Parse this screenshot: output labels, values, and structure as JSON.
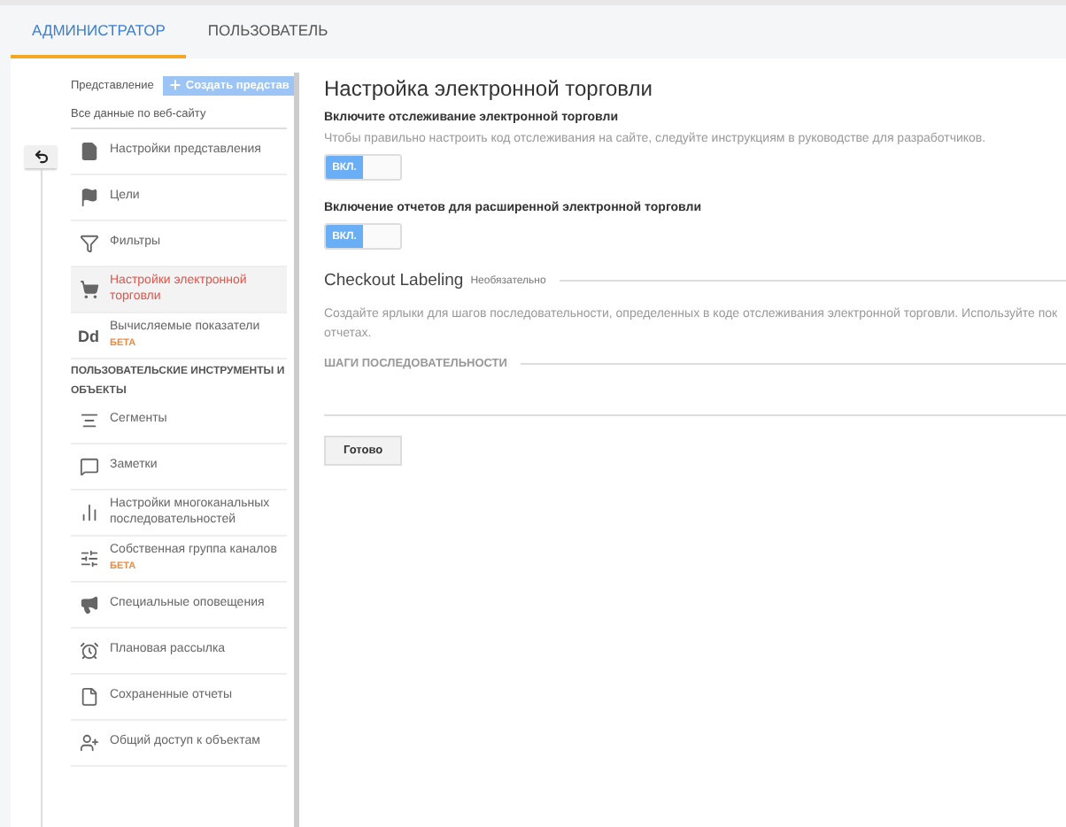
{
  "tabs": [
    {
      "label": "АДМИНИСТРАТОР",
      "selected": true
    },
    {
      "label": "ПОЛЬЗОВАТЕЛЬ",
      "selected": false
    }
  ],
  "view": {
    "label": "Представление",
    "create_button": "Создать представ",
    "subtitle": "Все данные по веб-сайту"
  },
  "nav_items": [
    {
      "kind": "item",
      "label": "Настройки представления",
      "selected": false
    },
    {
      "kind": "item",
      "label": "Цели",
      "selected": false
    },
    {
      "kind": "item",
      "label": "Фильтры",
      "selected": false
    },
    {
      "kind": "item",
      "label": "Настройки электронной торговли",
      "selected": true
    },
    {
      "kind": "item",
      "icon_text": "Dd",
      "label": "Вычисляемые показатели",
      "badge": "БЕТА",
      "selected": false
    },
    {
      "kind": "heading",
      "label": "ПОЛЬЗОВАТЕЛЬСКИЕ ИНСТРУМЕНТЫ И"
    },
    {
      "kind": "heading",
      "label": "ОБЪЕКТЫ"
    },
    {
      "kind": "item",
      "label": "Сегменты",
      "selected": false
    },
    {
      "kind": "item",
      "label": "Заметки",
      "selected": false
    },
    {
      "kind": "item",
      "label": "Настройки многоканальных последовательностей",
      "selected": false
    },
    {
      "kind": "item",
      "label": "Собственная группа каналов",
      "badge": "БЕТА",
      "selected": false
    },
    {
      "kind": "item",
      "label": "Специальные оповещения",
      "selected": false
    },
    {
      "kind": "item",
      "label": "Плановая рассылка",
      "selected": false
    },
    {
      "kind": "item",
      "label": "Сохраненные отчеты",
      "selected": false
    },
    {
      "kind": "item",
      "label": "Общий доступ к объектам",
      "selected": false
    }
  ],
  "main": {
    "title": "Настройка электронной торговли",
    "settings": [
      {
        "label": "Включите отслеживание электронной торговли",
        "hint": "Чтобы правильно настроить код отслеживания на сайте, следуйте инструкциям в руководстве для разработчиков.",
        "toggle": "ВКЛ.",
        "on": true
      },
      {
        "label": "Включение отчетов для расширенной электронной торговли",
        "toggle": "ВКЛ.",
        "on": true
      }
    ],
    "checkout": {
      "title": "Checkout Labeling",
      "optional": "Необязательно",
      "description": "Создайте ярлыки для шагов последовательности, определенных в коде отслеживания электронной торговли. Используйте пок",
      "description_end": "отчетах.",
      "steps_heading": "ШАГИ ПОСЛЕДОВАТЕЛЬНОСТИ"
    },
    "done_button": "Готово"
  }
}
